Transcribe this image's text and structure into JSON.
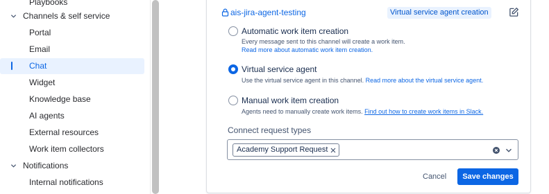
{
  "sidebar": {
    "items": [
      {
        "label": "Playbooks",
        "kind": "child"
      },
      {
        "label": "Channels & self service",
        "kind": "group",
        "expanded": true
      },
      {
        "label": "Portal",
        "kind": "child"
      },
      {
        "label": "Email",
        "kind": "child"
      },
      {
        "label": "Chat",
        "kind": "child",
        "active": true
      },
      {
        "label": "Widget",
        "kind": "child"
      },
      {
        "label": "Knowledge base",
        "kind": "child"
      },
      {
        "label": "AI agents",
        "kind": "child"
      },
      {
        "label": "External resources",
        "kind": "child"
      },
      {
        "label": "Work item collectors",
        "kind": "child"
      },
      {
        "label": "Notifications",
        "kind": "group",
        "expanded": true
      },
      {
        "label": "Internal notifications",
        "kind": "child"
      }
    ]
  },
  "card": {
    "channel_name": "ais-jira-agent-testing",
    "mode_badge": "Virtual service agent creation",
    "options": [
      {
        "title": "Automatic work item creation",
        "description": "Every message sent to this channel will create a work item.",
        "link": "Read more about automatic work item creation.",
        "selected": false
      },
      {
        "title": "Virtual service agent",
        "description": "Use the virtual service agent in this channel.",
        "link": "Read more about the virtual service agent.",
        "selected": true
      },
      {
        "title": "Manual work item creation",
        "description": "Agents need to manually create work items.",
        "link": "Find out how to create work items in Slack.",
        "selected": false
      }
    ],
    "request_types_label": "Connect request types",
    "selected_request_types": [
      "Academy Support Request"
    ],
    "cancel_label": "Cancel",
    "save_label": "Save changes"
  },
  "icons": {
    "lock": "lock-icon",
    "edit": "edit-icon",
    "clear": "clear-icon",
    "chevron": "chevron-down-icon"
  },
  "colors": {
    "accent": "#0c66e4",
    "badge_bg": "#e9f2ff",
    "text": "#172b4d"
  }
}
